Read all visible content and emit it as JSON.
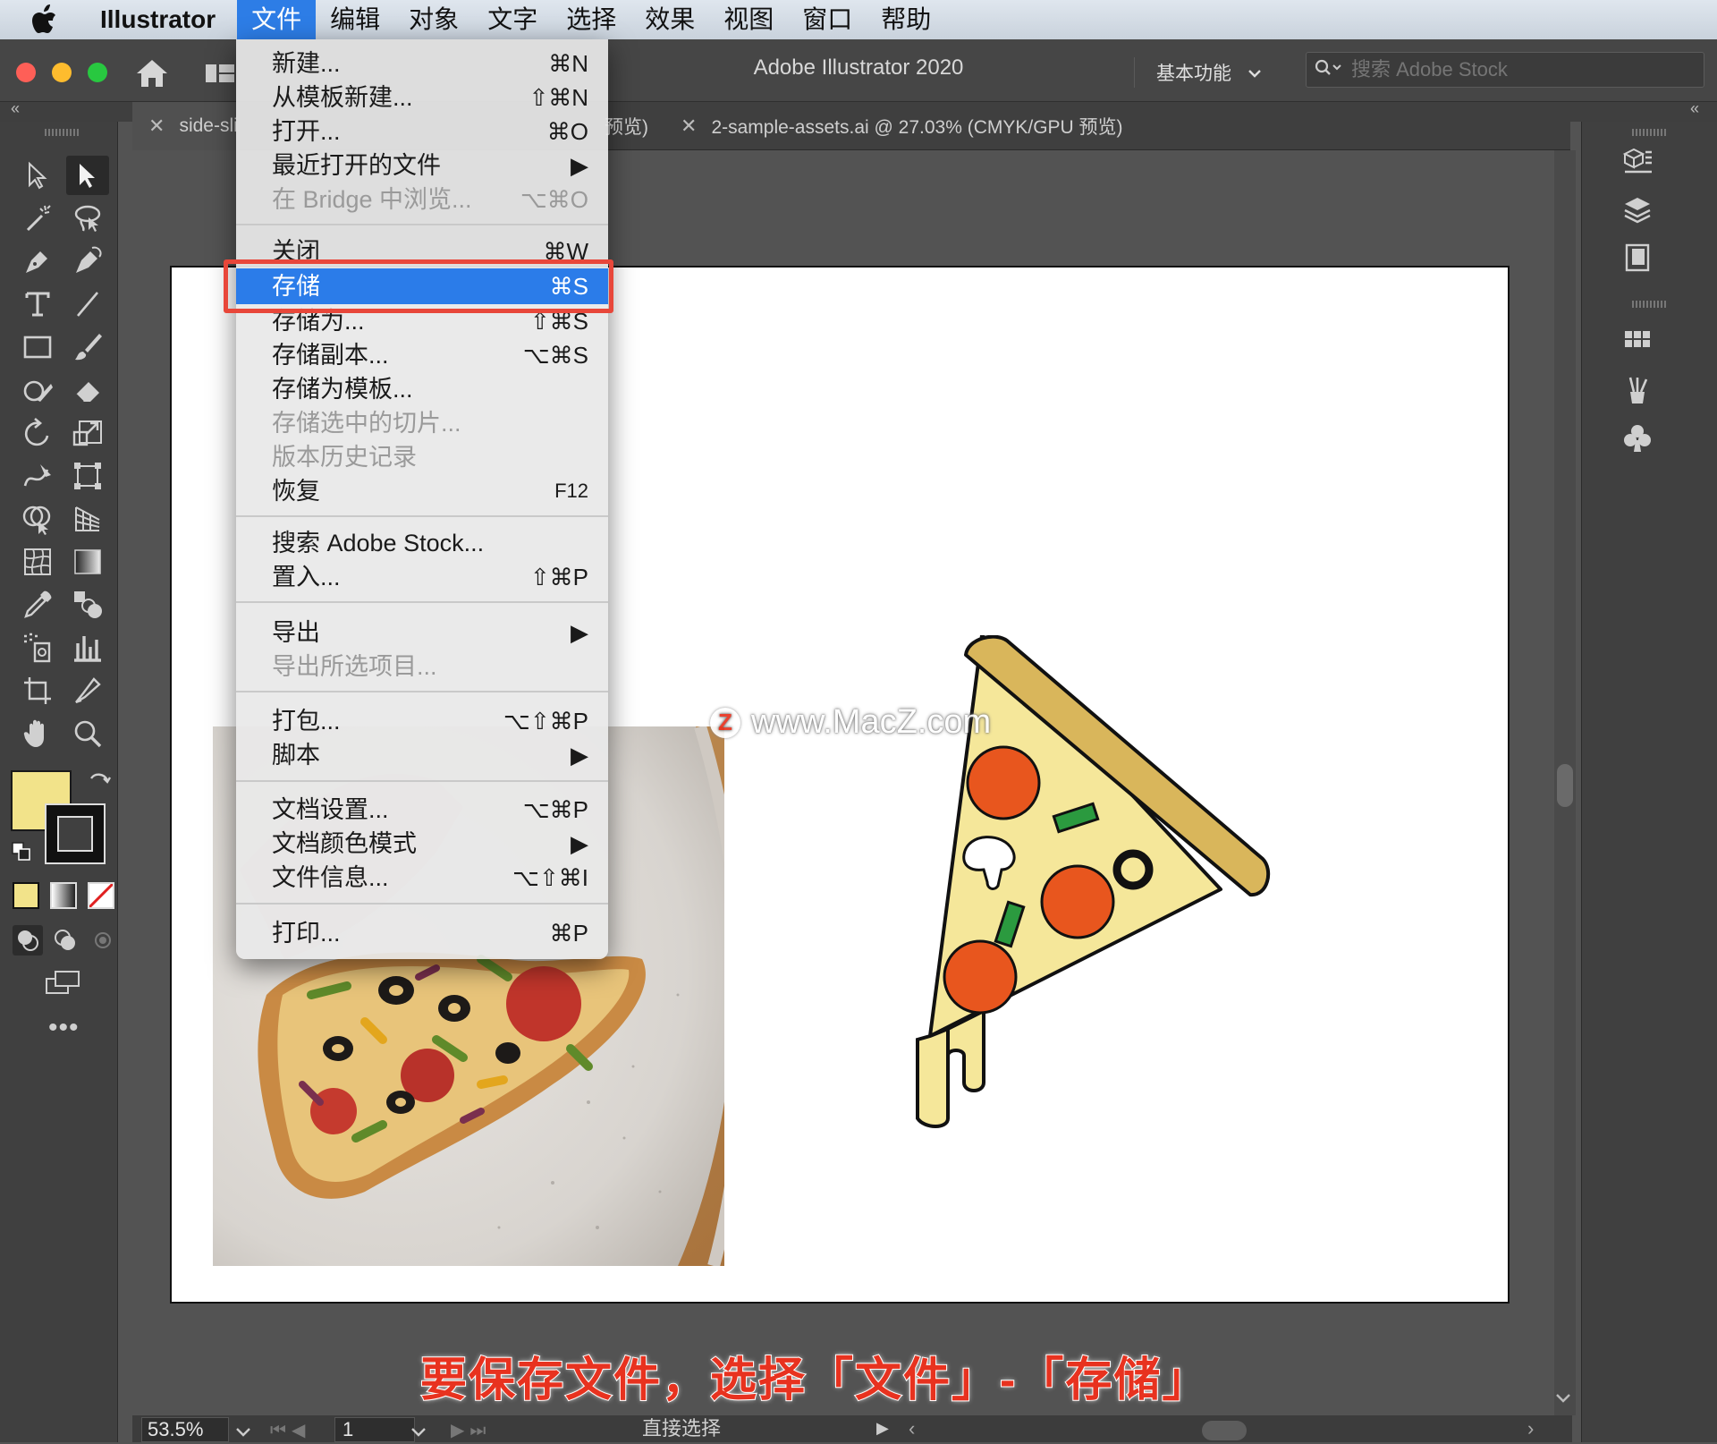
{
  "menubar": {
    "app_name": "Illustrator",
    "items": [
      "文件",
      "编辑",
      "对象",
      "文字",
      "选择",
      "效果",
      "视图",
      "窗口",
      "帮助"
    ]
  },
  "titlebar": {
    "title": "Adobe Illustrator 2020",
    "workspace": "基本功能",
    "stock_placeholder": "搜索 Adobe Stock"
  },
  "tabs": [
    {
      "label": "side-sli"
    },
    {
      "label": "预览)"
    },
    {
      "label": "2-sample-assets.ai @ 27.03% (CMYK/GPU 预览)"
    }
  ],
  "file_menu": {
    "items": [
      {
        "label": "新建...",
        "shortcut": "⌘N",
        "disabled": false
      },
      {
        "label": "从模板新建...",
        "shortcut": "⇧⌘N",
        "disabled": false
      },
      {
        "label": "打开...",
        "shortcut": "⌘O",
        "disabled": false
      },
      {
        "label": "最近打开的文件",
        "shortcut": "▶",
        "disabled": false
      },
      {
        "label": "在 Bridge 中浏览...",
        "shortcut": "⌥⌘O",
        "disabled": true
      },
      {
        "label": "关闭",
        "shortcut": "⌘W",
        "disabled": false
      },
      {
        "label": "存储",
        "shortcut": "⌘S",
        "disabled": false
      },
      {
        "label": "存储为...",
        "shortcut": "⇧⌘S",
        "disabled": false
      },
      {
        "label": "存储副本...",
        "shortcut": "⌥⌘S",
        "disabled": false
      },
      {
        "label": "存储为模板...",
        "shortcut": "",
        "disabled": false
      },
      {
        "label": "存储选中的切片...",
        "shortcut": "",
        "disabled": true
      },
      {
        "label": "版本历史记录",
        "shortcut": "",
        "disabled": true
      },
      {
        "label": "恢复",
        "shortcut": "F12",
        "disabled": false
      },
      {
        "label": "搜索 Adobe Stock...",
        "shortcut": "",
        "disabled": false
      },
      {
        "label": "置入...",
        "shortcut": "⇧⌘P",
        "disabled": false
      },
      {
        "label": "导出",
        "shortcut": "▶",
        "disabled": false
      },
      {
        "label": "导出所选项目...",
        "shortcut": "",
        "disabled": true
      },
      {
        "label": "打包...",
        "shortcut": "⌥⇧⌘P",
        "disabled": false
      },
      {
        "label": "脚本",
        "shortcut": "▶",
        "disabled": false
      },
      {
        "label": "文档设置...",
        "shortcut": "⌥⌘P",
        "disabled": false
      },
      {
        "label": "文档颜色模式",
        "shortcut": "▶",
        "disabled": false
      },
      {
        "label": "文件信息...",
        "shortcut": "⌥⇧⌘I",
        "disabled": false
      },
      {
        "label": "打印...",
        "shortcut": "⌘P",
        "disabled": false
      }
    ]
  },
  "status": {
    "zoom": "53.5%",
    "page": "1",
    "tool": "直接选择"
  },
  "watermark": "www.MacZ.com",
  "watermark_logo": "Z",
  "caption": "要保存文件，选择「文件」-「存储」",
  "colors": {
    "accent": "#2b7ce9",
    "highlight_border": "#e8473a",
    "fill_swatch": "#f2e38a",
    "caption": "#e8321f"
  },
  "icons": [
    "apple-icon",
    "home-icon",
    "arrange-documents-icon",
    "search-icon",
    "chevron-down-icon",
    "close-icon",
    "selection-tool-icon",
    "direct-selection-tool-icon",
    "magic-wand-icon",
    "lasso-icon",
    "pen-icon",
    "curvature-icon",
    "type-icon",
    "line-icon",
    "rectangle-icon",
    "paintbrush-icon",
    "shaper-icon",
    "eraser-icon",
    "rotate-icon",
    "scale-icon",
    "warp-icon",
    "free-transform-icon",
    "shape-builder-icon",
    "perspective-grid-icon",
    "mesh-icon",
    "gradient-icon",
    "eyedropper-icon",
    "blend-icon",
    "symbol-sprayer-icon",
    "column-graph-icon",
    "artboard-icon",
    "slice-icon",
    "hand-icon",
    "zoom-icon",
    "properties-panel-icon",
    "layers-panel-icon",
    "libraries-panel-icon",
    "swatches-panel-icon",
    "brushes-panel-icon",
    "symbols-panel-icon"
  ]
}
